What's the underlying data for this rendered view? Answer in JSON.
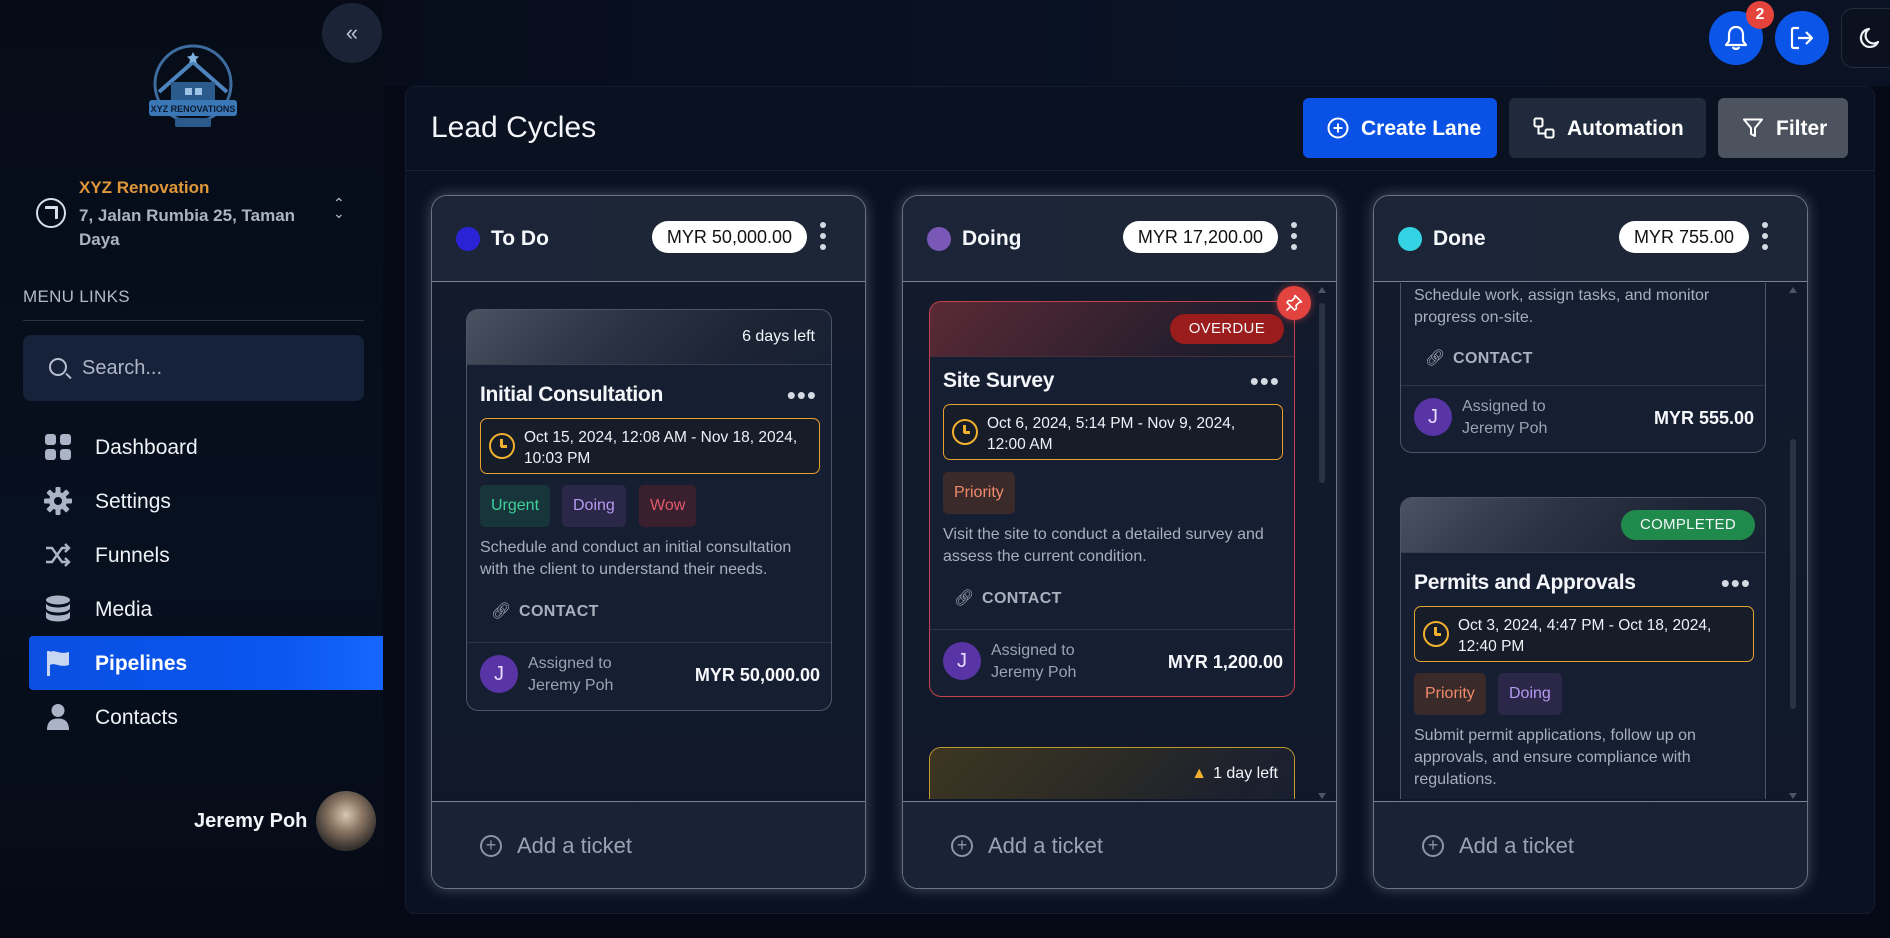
{
  "sidebar": {
    "collapse_icon": "chevrons-left-icon",
    "logo_text": "XYZ RENOVATIONS",
    "org_name": "XYZ Renovation",
    "org_address": "7, Jalan Rumbia 25, Taman Daya",
    "menu_title": "MENU LINKS",
    "search_placeholder": "Search...",
    "items": [
      {
        "label": "Dashboard",
        "icon": "grid-icon"
      },
      {
        "label": "Settings",
        "icon": "gear-icon"
      },
      {
        "label": "Funnels",
        "icon": "shuffle-icon"
      },
      {
        "label": "Media",
        "icon": "database-icon"
      },
      {
        "label": "Pipelines",
        "icon": "flag-icon",
        "active": true
      },
      {
        "label": "Contacts",
        "icon": "user-icon"
      }
    ],
    "user_name": "Jeremy Poh"
  },
  "topbar": {
    "notification_count": "2",
    "icons": [
      "bell-icon",
      "logout-icon",
      "moon-icon"
    ]
  },
  "page": {
    "title": "Lead Cycles",
    "buttons": {
      "create_lane": "Create Lane",
      "automation": "Automation",
      "filter": "Filter"
    }
  },
  "colors": {
    "accent": "#0a52e6",
    "todo_dot": "#2a23d6",
    "doing_dot": "#7a58b8",
    "done_dot": "#33d3e3",
    "overdue": "#9b1c1c",
    "completed": "#1f8a4b",
    "date_border": "#e9a12e"
  },
  "lanes": [
    {
      "title": "To Do",
      "amount": "MYR 50,000.00",
      "add_label": "Add a ticket",
      "tickets": [
        {
          "time_left": "6 days left",
          "title": "Initial Consultation",
          "dates": "Oct 15, 2024, 12:08 AM - Nov 18, 2024, 10:03 PM",
          "tags": [
            "Urgent",
            "Doing",
            "Wow"
          ],
          "description": "Schedule and conduct an initial consultation with the client to understand their needs.",
          "contact": "CONTACT",
          "avatar": "J",
          "assigned": "Assigned to Jeremy Poh",
          "amount": "MYR 50,000.00"
        }
      ]
    },
    {
      "title": "Doing",
      "amount": "MYR 17,200.00",
      "add_label": "Add a ticket",
      "tickets": [
        {
          "status": "OVERDUE",
          "title": "Site Survey",
          "dates": "Oct 6, 2024, 5:14 PM - Nov 9, 2024, 12:00 AM",
          "tags": [
            "Priority"
          ],
          "description": "Visit the site to conduct a detailed survey and assess the current condition.",
          "contact": "CONTACT",
          "avatar": "J",
          "assigned": "Assigned to Jeremy Poh",
          "amount": "MYR 1,200.00"
        },
        {
          "time_left": "1 day left"
        }
      ]
    },
    {
      "title": "Done",
      "amount": "MYR 755.00",
      "add_label": "Add a ticket",
      "tickets": [
        {
          "description": "Schedule work, assign tasks, and monitor progress on-site.",
          "contact": "CONTACT",
          "avatar": "J",
          "assigned": "Assigned to Jeremy Poh",
          "amount": "MYR 555.00"
        },
        {
          "status": "COMPLETED",
          "title": "Permits and Approvals",
          "dates": "Oct 3, 2024, 4:47 PM - Oct 18, 2024, 12:40 PM",
          "tags": [
            "Priority",
            "Doing"
          ],
          "description": "Submit permit applications, follow up on approvals, and ensure compliance with regulations."
        }
      ]
    }
  ]
}
